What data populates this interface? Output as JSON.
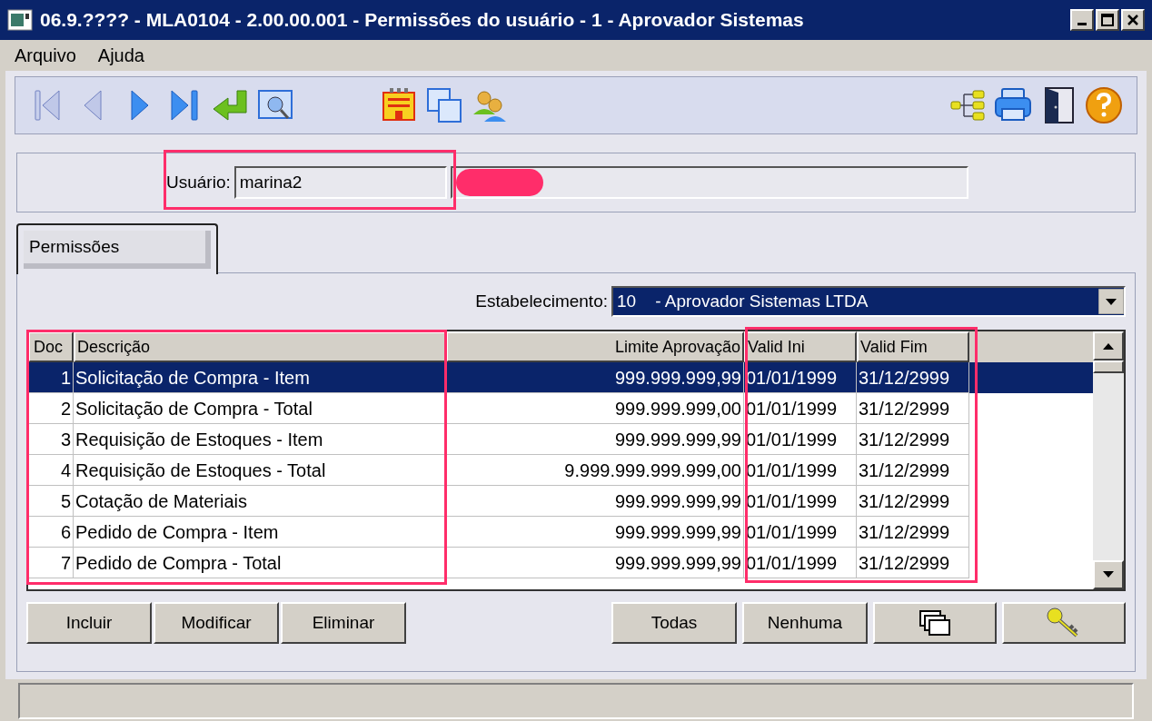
{
  "window": {
    "title": "06.9.???? - MLA0104 - 2.00.00.001 - Permissões do usuário - 1 - Aprovador Sistemas"
  },
  "menu": [
    "Arquivo",
    "Ajuda"
  ],
  "user": {
    "label": "Usuário:",
    "value": "marina2"
  },
  "tabs": [
    {
      "label": "Permissões",
      "selected": true
    }
  ],
  "establishment": {
    "label": "Estabelecimento:",
    "value": "10    - Aprovador Sistemas LTDA"
  },
  "table": {
    "columns": [
      "Doc",
      "Descrição",
      "Limite Aprovação",
      "Valid Ini",
      "Valid Fim"
    ],
    "rows": [
      {
        "doc": "1",
        "description": "Solicitação de Compra - Item",
        "limit": "999.999.999,99",
        "valid_ini": "01/01/1999",
        "valid_fim": "31/12/2999",
        "selected": true
      },
      {
        "doc": "2",
        "description": "Solicitação de Compra - Total",
        "limit": "999.999.999,00",
        "valid_ini": "01/01/1999",
        "valid_fim": "31/12/2999",
        "selected": false
      },
      {
        "doc": "3",
        "description": "Requisição de Estoques - Item",
        "limit": "999.999.999,99",
        "valid_ini": "01/01/1999",
        "valid_fim": "31/12/2999",
        "selected": false
      },
      {
        "doc": "4",
        "description": "Requisição de Estoques - Total",
        "limit": "9.999.999.999.999,00",
        "valid_ini": "01/01/1999",
        "valid_fim": "31/12/2999",
        "selected": false
      },
      {
        "doc": "5",
        "description": "Cotação de Materiais",
        "limit": "999.999.999,99",
        "valid_ini": "01/01/1999",
        "valid_fim": "31/12/2999",
        "selected": false
      },
      {
        "doc": "6",
        "description": "Pedido de Compra - Item",
        "limit": "999.999.999,99",
        "valid_ini": "01/01/1999",
        "valid_fim": "31/12/2999",
        "selected": false
      },
      {
        "doc": "7",
        "description": "Pedido de Compra - Total",
        "limit": "999.999.999,99",
        "valid_ini": "01/01/1999",
        "valid_fim": "31/12/2999",
        "selected": false
      }
    ]
  },
  "left_buttons": [
    "Incluir",
    "Modificar",
    "Eliminar"
  ],
  "right_buttons": [
    "Todas",
    "Nenhuma"
  ]
}
